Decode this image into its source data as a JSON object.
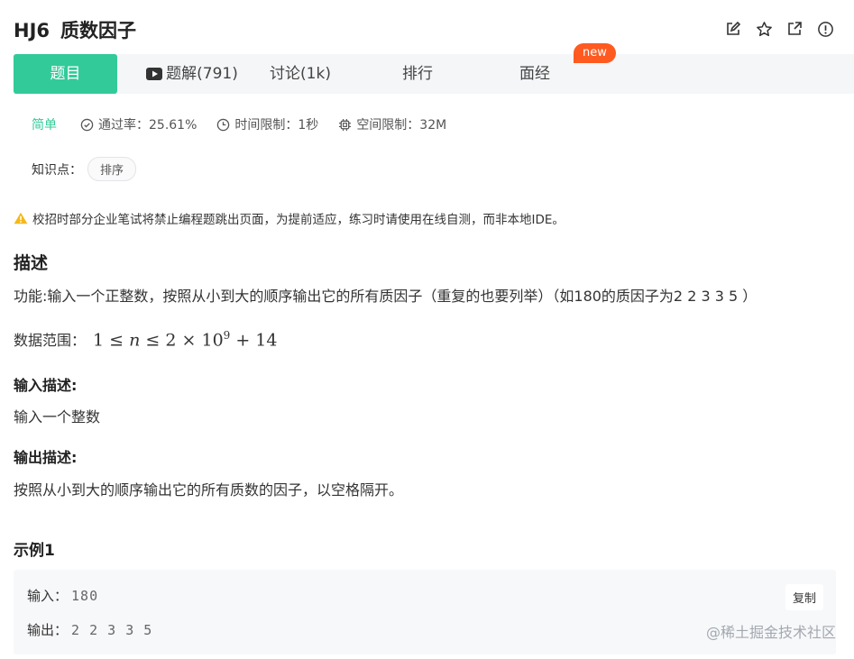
{
  "problem": {
    "id": "HJ6",
    "title": "质数因子"
  },
  "icons": [
    "edit-icon",
    "star-icon",
    "external-link-icon",
    "report-icon"
  ],
  "tabs": [
    {
      "label": "题目"
    },
    {
      "label": "题解(791)"
    },
    {
      "label": "讨论(1k)"
    },
    {
      "label": "排行"
    },
    {
      "label": "面经"
    }
  ],
  "new_badge": "new",
  "meta": {
    "difficulty": "简单",
    "pass_rate": "通过率：25.61%",
    "time_limit": "时间限制：1秒",
    "memory_limit": "空间限制：32M"
  },
  "knowledge": {
    "label": "知识点：",
    "tag": "排序"
  },
  "notice": "校招时部分企业笔试将禁止编程题跳出页面，为提前适应，练习时请使用在线自测，而非本地IDE。",
  "description": {
    "heading": "描述",
    "text": "功能:输入一个正整数，按照从小到大的顺序输出它的所有质因子（重复的也要列举）（如180的质因子为2 2 3 3 5 ）",
    "range_label": "数据范围：",
    "range_math": {
      "left": "1",
      "le1": "≤",
      "var": "n",
      "le2": "≤",
      "base": "2 × 10",
      "exp": "9",
      "tail": "+ 14"
    }
  },
  "input_desc": {
    "heading": "输入描述:",
    "text": "输入一个整数"
  },
  "output_desc": {
    "heading": "输出描述:",
    "text": "按照从小到大的顺序输出它的所有质数的因子，以空格隔开。"
  },
  "example": {
    "heading": "示例1",
    "input_label": "输入：",
    "input_value": "180",
    "output_label": "输出：",
    "output_value": "2 2 3 3 5",
    "copy_label": "复制"
  },
  "watermark": "@稀土掘金技术社区",
  "colors": {
    "accent": "#32ca99",
    "badge": "#ff5a1f",
    "warning": "#f5b81b"
  }
}
